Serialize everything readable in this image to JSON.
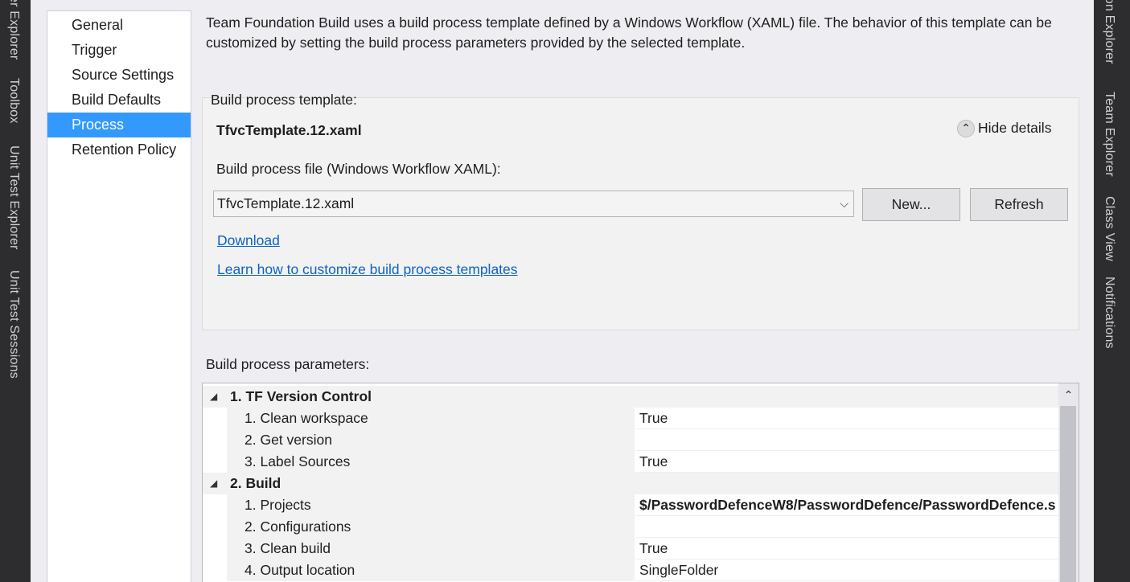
{
  "left_tabs": [
    "er Explorer",
    "Toolbox",
    "Unit Test Explorer",
    "Unit Test Sessions"
  ],
  "right_tabs": [
    "ion Explorer",
    "Team Explorer",
    "Class View",
    "Notifications"
  ],
  "nav": {
    "items": [
      {
        "label": "General"
      },
      {
        "label": "Trigger"
      },
      {
        "label": "Source Settings"
      },
      {
        "label": "Build Defaults"
      },
      {
        "label": "Process",
        "selected": true
      },
      {
        "label": "Retention Policy"
      }
    ]
  },
  "intro_text": "Team Foundation Build uses a build process template defined by a Windows Workflow (XAML) file. The behavior of this template can be customized by setting the build process parameters provided by the selected template.",
  "template": {
    "section_label": "Build process template:",
    "name": "TfvcTemplate.12.xaml",
    "hide_details_label": "Hide details",
    "file_label": "Build process file (Windows Workflow XAML):",
    "file_selected": "TfvcTemplate.12.xaml",
    "new_button": "New...",
    "refresh_button": "Refresh",
    "download_link": "Download",
    "learn_link": "Learn how to customize build process templates"
  },
  "params": {
    "label": "Build process parameters:",
    "rows": [
      {
        "type": "category",
        "name": "1. TF Version Control"
      },
      {
        "type": "param",
        "name": "1. Clean workspace",
        "value": "True"
      },
      {
        "type": "param",
        "name": "2. Get version",
        "value": ""
      },
      {
        "type": "param",
        "name": "3. Label Sources",
        "value": "True"
      },
      {
        "type": "category",
        "name": "2. Build"
      },
      {
        "type": "param",
        "name": "1. Projects",
        "value": "$/PasswordDefenceW8/PasswordDefence/PasswordDefence.s",
        "bold": true
      },
      {
        "type": "param",
        "name": "2. Configurations",
        "value": ""
      },
      {
        "type": "param",
        "name": "3. Clean build",
        "value": "True"
      },
      {
        "type": "param",
        "name": "4. Output location",
        "value": "SingleFolder"
      }
    ]
  },
  "colors": {
    "selection": "#3399ff",
    "link": "#0e62c6",
    "chrome": "#2d2d30"
  }
}
